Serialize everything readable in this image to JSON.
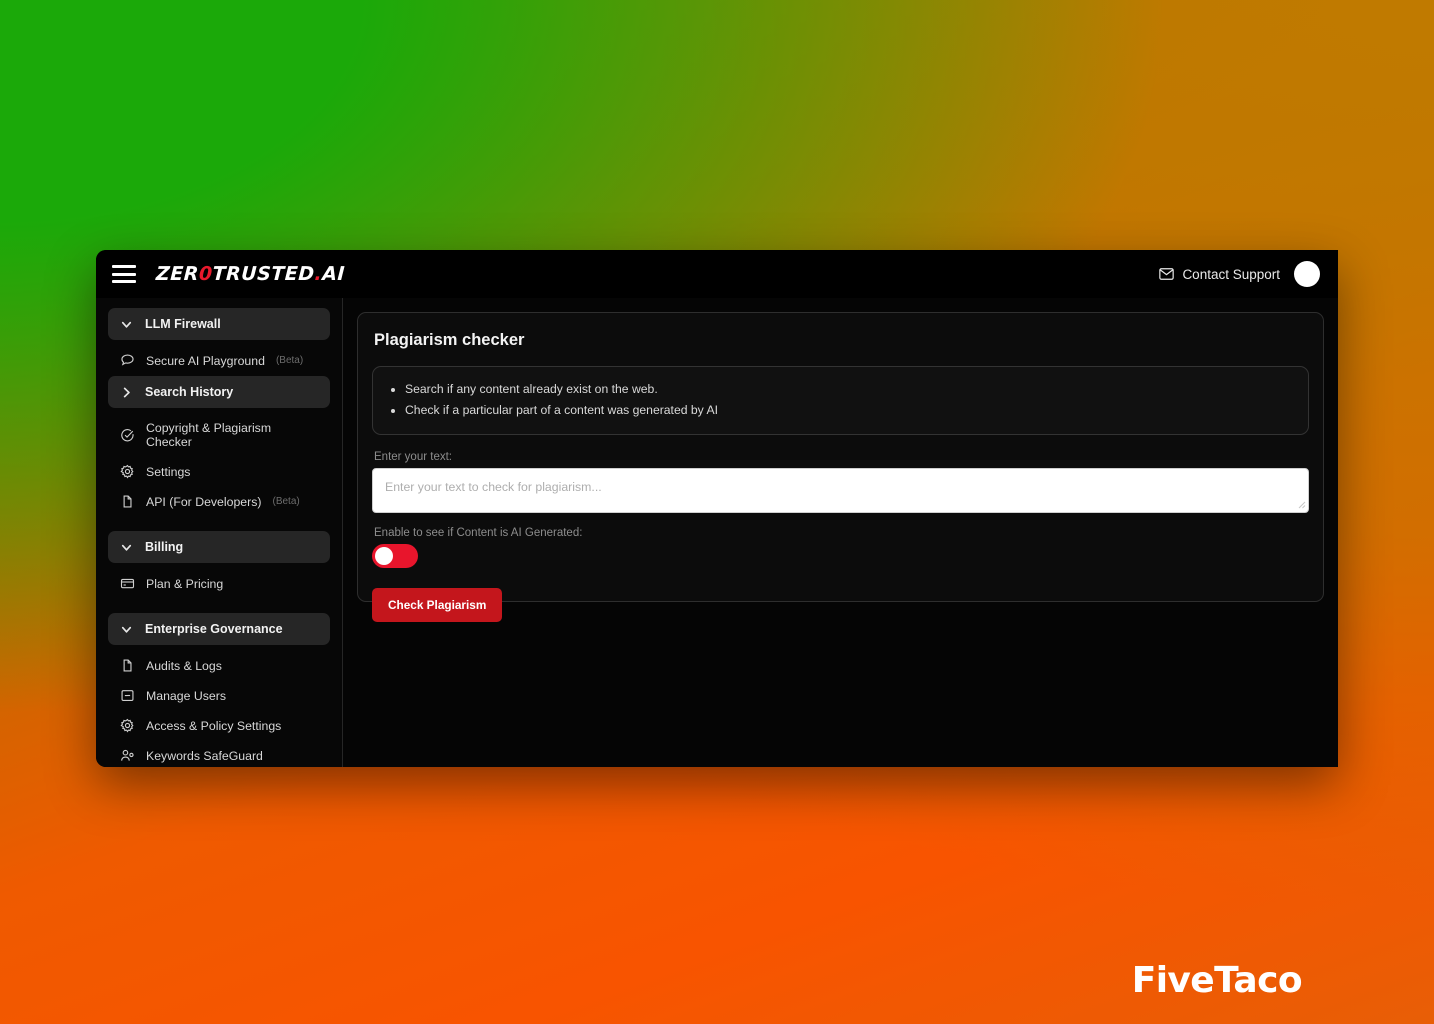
{
  "window": {
    "topbar": {
      "menu_icon": "hamburger-menu-icon",
      "logo": {
        "pre": "ZER",
        "zero": "0",
        "post": "TRUSTED",
        "dot": ".",
        "suffix": "AI"
      },
      "support_label": "Contact Support",
      "support_icon": "envelope-icon",
      "avatar_icon": "user-avatar"
    },
    "sidebar": {
      "groups": [
        {
          "header": {
            "label": "LLM Firewall",
            "icon": "chevron-down-icon",
            "expanded": true
          },
          "items": [
            {
              "label": "Secure AI Playground",
              "badge": "(Beta)",
              "icon": "chat-bubble-icon"
            }
          ]
        },
        {
          "header": {
            "label": "Search History",
            "icon": "chevron-right-icon",
            "expanded": false
          },
          "items": [
            {
              "label": "Copyright & Plagiarism Checker",
              "badge": "",
              "icon": "check-circle-icon"
            },
            {
              "label": "Settings",
              "badge": "",
              "icon": "gear-icon"
            },
            {
              "label": "API (For Developers)",
              "badge": "(Beta)",
              "icon": "document-copy-icon"
            }
          ]
        },
        {
          "header": {
            "label": "Billing",
            "icon": "chevron-down-icon",
            "expanded": true
          },
          "items": [
            {
              "label": "Plan & Pricing",
              "badge": "",
              "icon": "credit-card-icon"
            }
          ]
        },
        {
          "header": {
            "label": "Enterprise Governance",
            "icon": "chevron-down-icon",
            "expanded": true
          },
          "items": [
            {
              "label": "Audits & Logs",
              "badge": "",
              "icon": "document-copy-icon"
            },
            {
              "label": "Manage Users",
              "badge": "",
              "icon": "id-card-icon"
            },
            {
              "label": "Access & Policy Settings",
              "badge": "",
              "icon": "gear-icon"
            },
            {
              "label": "Keywords SafeGuard",
              "badge": "",
              "icon": "users-icon"
            }
          ]
        }
      ]
    },
    "main": {
      "title": "Plagiarism checker",
      "info_bullets": [
        "Search if any content already exist on the web.",
        "Check if a particular part of a content was generated by AI"
      ],
      "text_field": {
        "label": "Enter your text:",
        "placeholder": "Enter your text to check for plagiarism...",
        "value": ""
      },
      "toggle": {
        "label": "Enable to see if Content is AI Generated:",
        "state": "off"
      },
      "submit_label": "Check Plagiarism"
    }
  },
  "watermark": {
    "text": "FiveTaco"
  },
  "colors": {
    "accent_red": "#c4161c",
    "toggle_red": "#e8152c",
    "logo_red": "#e8192c",
    "bg_green": "#1ba909",
    "bg_orange": "#f85400"
  }
}
